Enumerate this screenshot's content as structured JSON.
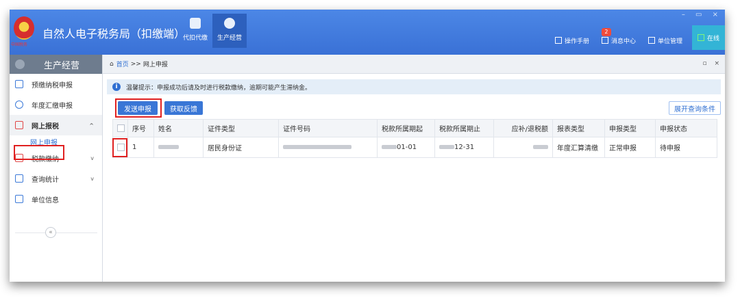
{
  "header": {
    "app_title": "自然人电子税务局（扣缴端）",
    "emblem_caption": "中国税务",
    "nav": [
      {
        "label": "代扣代缴",
        "active": false
      },
      {
        "label": "生产经营",
        "active": true
      }
    ],
    "right_menu": {
      "manual": "操作手册",
      "messages": "消息中心",
      "message_count": "2",
      "unit_manage": "单位管理",
      "online": "在线"
    }
  },
  "sidebar": {
    "title": "生产经营",
    "items": [
      {
        "label": "预缴纳税申报"
      },
      {
        "label": "年度汇缴申报"
      },
      {
        "label": "网上报税",
        "chevron": "^"
      },
      {
        "label": "网上申报"
      },
      {
        "label": "税款缴纳",
        "chevron": "v"
      },
      {
        "label": "查询统计",
        "chevron": "v"
      },
      {
        "label": "单位信息"
      }
    ],
    "collapse": "«"
  },
  "breadcrumb": {
    "home": "首页",
    "sep": ">>",
    "current": "网上申报"
  },
  "notice": "温馨提示：申报成功后请及时进行税款缴纳，逾期可能产生滞纳金。",
  "toolbar": {
    "send_label": "发送申报",
    "feedback_label": "获取反馈",
    "expand_label": "展开查询条件"
  },
  "table": {
    "headers": [
      "序号",
      "姓名",
      "证件类型",
      "证件号码",
      "税款所属期起",
      "税款所属期止",
      "应补/退税额",
      "报表类型",
      "申报类型",
      "申报状态"
    ],
    "rows": [
      {
        "index": "1",
        "id_type": "居民身份证",
        "period_start": "01-01",
        "period_end": "12-31",
        "report_type": "年度汇算清缴",
        "declare_type": "正常申报",
        "status": "待申报"
      }
    ]
  },
  "colors": {
    "header_blue": "#3a71d6",
    "button_blue": "#3976d6",
    "highlight_red": "#e02020",
    "sidebar_head": "#6e7c8e"
  }
}
